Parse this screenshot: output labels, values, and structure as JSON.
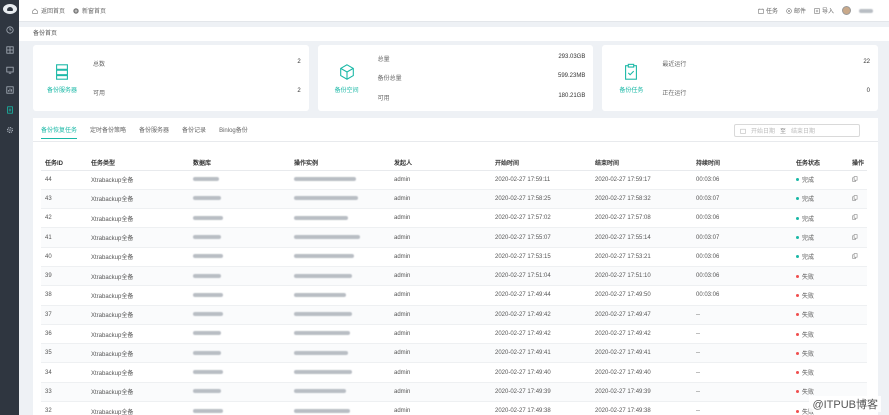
{
  "topbar": {
    "links": [
      {
        "label": "返回首页",
        "icon": "home-icon"
      },
      {
        "label": "新窗首页",
        "icon": "plus-circle-icon"
      }
    ],
    "right": [
      {
        "label": "任务",
        "icon": "task-icon"
      },
      {
        "label": "邮件",
        "icon": "mail-icon"
      },
      {
        "label": "导入",
        "icon": "import-icon"
      }
    ]
  },
  "breadcrumb": "备份首页",
  "cards": [
    {
      "name": "备份服务器",
      "icon": "server-icon",
      "rows": [
        {
          "label": "总数",
          "value": "2"
        },
        {
          "label": "可用",
          "value": "2"
        }
      ]
    },
    {
      "name": "备份空间",
      "icon": "box-icon",
      "rows": [
        {
          "label": "总量",
          "value": "293.03GB"
        },
        {
          "label": "备份总量",
          "value": "599.23MB"
        },
        {
          "label": "可用",
          "value": "180.21GB"
        }
      ]
    },
    {
      "name": "备份任务",
      "icon": "clipboard-check-icon",
      "rows": [
        {
          "label": "最近运行",
          "value": "22"
        },
        {
          "label": "正在运行",
          "value": "0"
        }
      ]
    }
  ],
  "tabs": [
    "备份恢复任务",
    "定时备份策略",
    "备份服务器",
    "备份记录",
    "Binlog备份"
  ],
  "date_range": {
    "start_placeholder": "开始日期",
    "separator": "至",
    "end_placeholder": "结束日期"
  },
  "table": {
    "headers": [
      "任务ID",
      "任务类型",
      "数据库",
      "操作实例",
      "发起人",
      "开始时间",
      "结束时间",
      "持续时间",
      "任务状态",
      "操作"
    ],
    "rows": [
      {
        "id": "44",
        "type": "Xtrabackup全备",
        "initiator": "admin",
        "start": "2020-02-27 17:59:11",
        "end": "2020-02-27 17:59:17",
        "duration": "00:03:06",
        "status": "完成",
        "status_kind": "ok"
      },
      {
        "id": "43",
        "type": "Xtrabackup全备",
        "initiator": "admin",
        "start": "2020-02-27 17:58:25",
        "end": "2020-02-27 17:58:32",
        "duration": "00:03:07",
        "status": "完成",
        "status_kind": "ok"
      },
      {
        "id": "42",
        "type": "Xtrabackup全备",
        "initiator": "admin",
        "start": "2020-02-27 17:57:02",
        "end": "2020-02-27 17:57:08",
        "duration": "00:03:06",
        "status": "完成",
        "status_kind": "ok"
      },
      {
        "id": "41",
        "type": "Xtrabackup全备",
        "initiator": "admin",
        "start": "2020-02-27 17:55:07",
        "end": "2020-02-27 17:55:14",
        "duration": "00:03:07",
        "status": "完成",
        "status_kind": "ok"
      },
      {
        "id": "40",
        "type": "Xtrabackup全备",
        "initiator": "admin",
        "start": "2020-02-27 17:53:15",
        "end": "2020-02-27 17:53:21",
        "duration": "00:03:06",
        "status": "完成",
        "status_kind": "ok"
      },
      {
        "id": "39",
        "type": "Xtrabackup全备",
        "initiator": "admin",
        "start": "2020-02-27 17:51:04",
        "end": "2020-02-27 17:51:10",
        "duration": "00:03:06",
        "status": "失败",
        "status_kind": "fail"
      },
      {
        "id": "38",
        "type": "Xtrabackup全备",
        "initiator": "admin",
        "start": "2020-02-27 17:49:44",
        "end": "2020-02-27 17:49:50",
        "duration": "00:03:06",
        "status": "失败",
        "status_kind": "fail"
      },
      {
        "id": "37",
        "type": "Xtrabackup全备",
        "initiator": "admin",
        "start": "2020-02-27 17:49:42",
        "end": "2020-02-27 17:49:47",
        "duration": "--",
        "status": "失败",
        "status_kind": "fail"
      },
      {
        "id": "36",
        "type": "Xtrabackup全备",
        "initiator": "admin",
        "start": "2020-02-27 17:49:42",
        "end": "2020-02-27 17:49:42",
        "duration": "--",
        "status": "失败",
        "status_kind": "fail"
      },
      {
        "id": "35",
        "type": "Xtrabackup全备",
        "initiator": "admin",
        "start": "2020-02-27 17:49:41",
        "end": "2020-02-27 17:49:41",
        "duration": "--",
        "status": "失败",
        "status_kind": "fail"
      },
      {
        "id": "34",
        "type": "Xtrabackup全备",
        "initiator": "admin",
        "start": "2020-02-27 17:49:40",
        "end": "2020-02-27 17:49:40",
        "duration": "--",
        "status": "失败",
        "status_kind": "fail"
      },
      {
        "id": "33",
        "type": "Xtrabackup全备",
        "initiator": "admin",
        "start": "2020-02-27 17:49:39",
        "end": "2020-02-27 17:49:39",
        "duration": "--",
        "status": "失败",
        "status_kind": "fail"
      },
      {
        "id": "32",
        "type": "Xtrabackup全备",
        "initiator": "admin",
        "start": "2020-02-27 17:49:38",
        "end": "2020-02-27 17:49:38",
        "duration": "--",
        "status": "失败",
        "status_kind": "fail"
      }
    ]
  },
  "watermark": "@ITPUB博客",
  "colors": {
    "accent": "#19b8a6",
    "fail": "#f04e4e",
    "sidebar": "#2f3640"
  }
}
